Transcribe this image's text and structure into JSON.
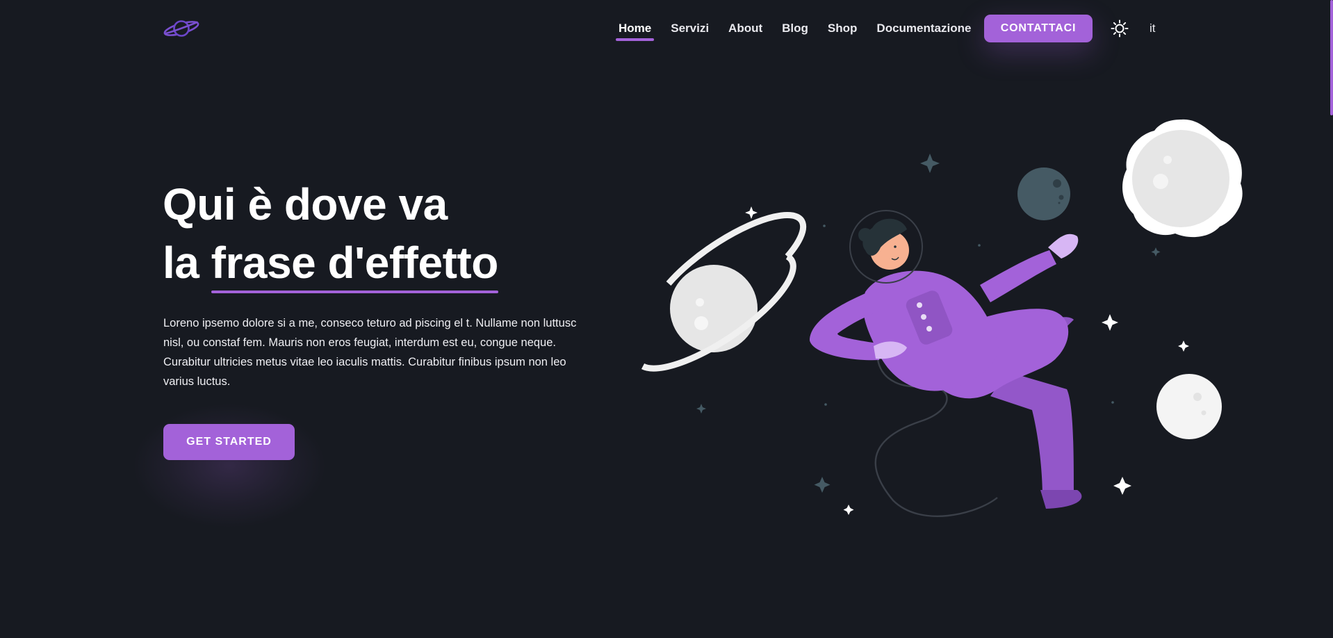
{
  "header": {
    "nav": [
      "Home",
      "Servizi",
      "About",
      "Blog",
      "Shop",
      "Documentazione"
    ],
    "active_nav": "Home",
    "contact_label": "CONTATTACI",
    "language": "it"
  },
  "hero": {
    "title_line1": "Qui è dove va",
    "title_line2_prefix": "la ",
    "title_highlight": "frase d'effetto",
    "paragraph": "Loreno ipsemo dolore si a me, conseco teturo ad piscing el t. Nullame non luttusc nisl, ou constaf fem. Mauris non eros feugiat, interdum est eu, congue neque. Curabitur ultricies metus vitae leo iaculis mattis. Curabitur finibus ipsum non leo varius luctus.",
    "cta_label": "GET STARTED"
  },
  "colors": {
    "background": "#171a21",
    "accent": "#a362d9",
    "text": "#ffffff"
  },
  "icons": [
    "planet-logo-icon",
    "sun-icon"
  ]
}
